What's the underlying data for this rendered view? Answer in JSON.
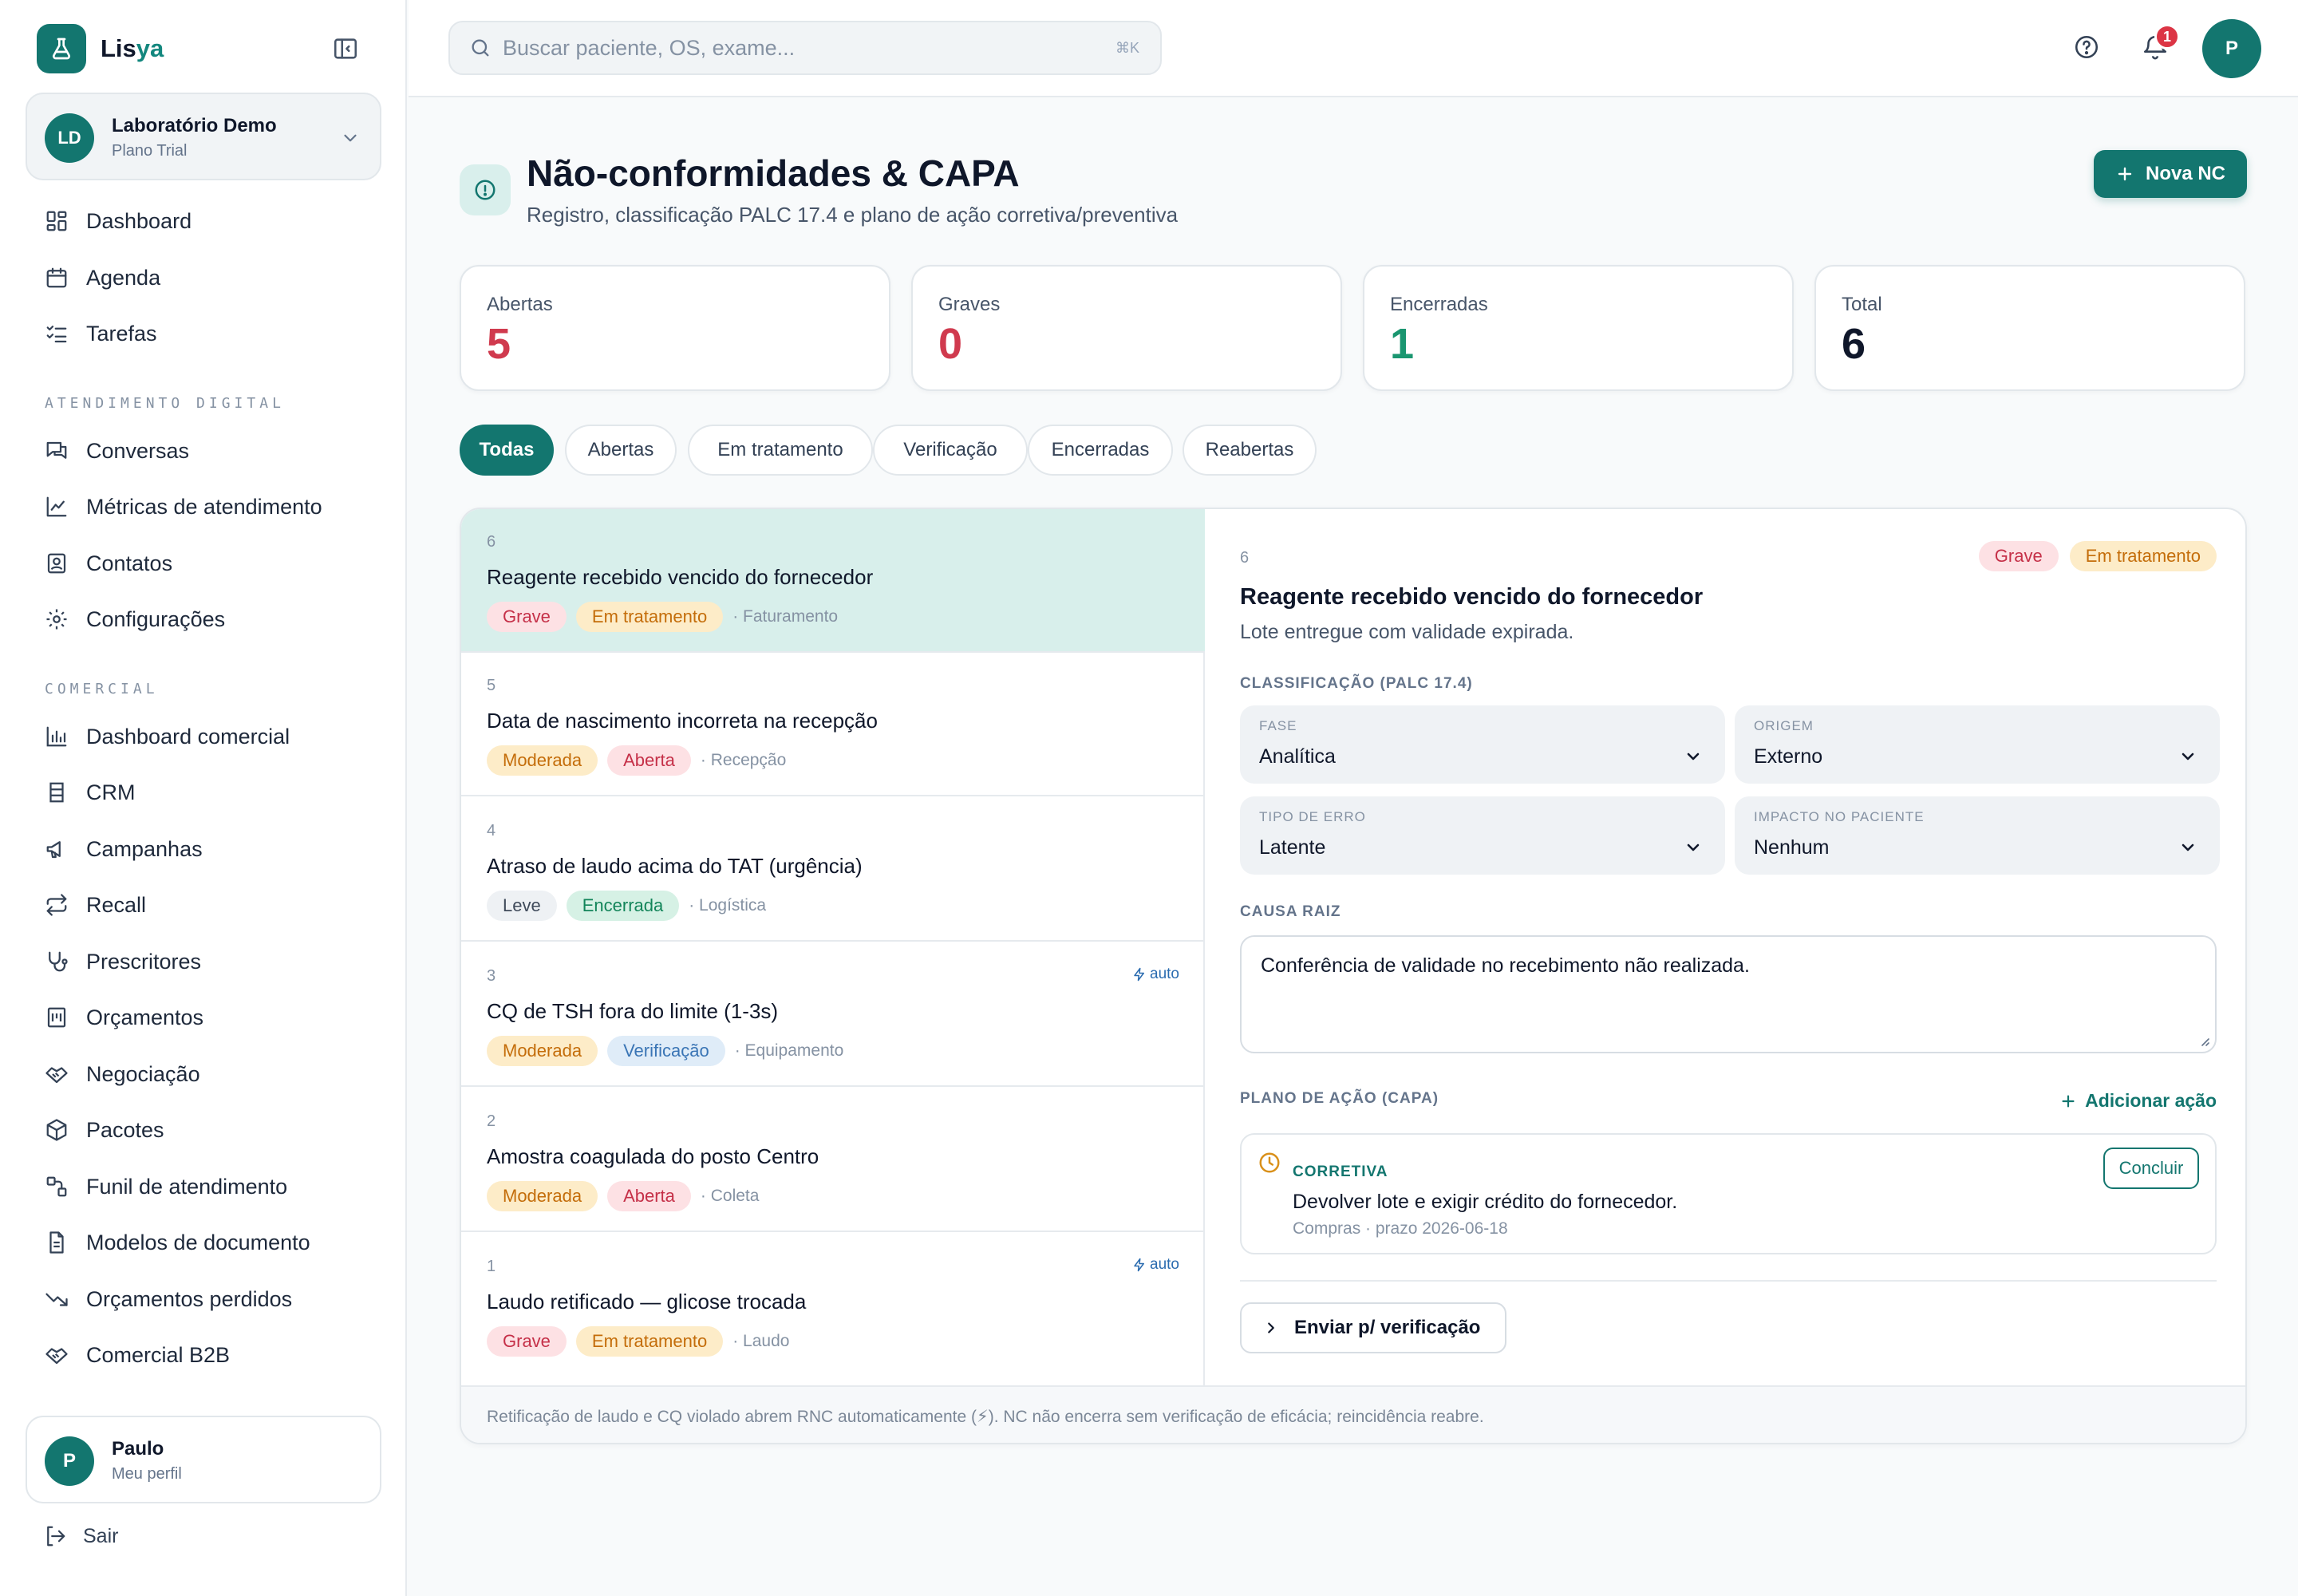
{
  "brand": {
    "name_prefix": "Lis",
    "name_suffix": "ya"
  },
  "org": {
    "initials": "LD",
    "name": "Laboratório Demo",
    "plan": "Plano Trial"
  },
  "nav": {
    "main": [
      {
        "label": "Dashboard",
        "icon": "dashboard-icon"
      },
      {
        "label": "Agenda",
        "icon": "calendar-icon"
      },
      {
        "label": "Tarefas",
        "icon": "tasks-icon"
      }
    ],
    "section_atendimento": "ATENDIMENTO DIGITAL",
    "atendimento": [
      {
        "label": "Conversas",
        "icon": "chat-icon"
      },
      {
        "label": "Métricas de atendimento",
        "icon": "line-chart-icon"
      },
      {
        "label": "Contatos",
        "icon": "contacts-icon"
      },
      {
        "label": "Configurações",
        "icon": "gear-icon"
      }
    ],
    "section_comercial": "COMERCIAL",
    "comercial": [
      {
        "label": "Dashboard comercial",
        "icon": "bar-chart-icon"
      },
      {
        "label": "CRM",
        "icon": "crm-icon"
      },
      {
        "label": "Campanhas",
        "icon": "megaphone-icon"
      },
      {
        "label": "Recall",
        "icon": "repeat-icon"
      },
      {
        "label": "Prescritores",
        "icon": "stethoscope-icon"
      },
      {
        "label": "Orçamentos",
        "icon": "receipt-icon"
      },
      {
        "label": "Negociação",
        "icon": "handshake-icon"
      },
      {
        "label": "Pacotes",
        "icon": "package-icon"
      },
      {
        "label": "Funil de atendimento",
        "icon": "funnel-icon"
      },
      {
        "label": "Modelos de documento",
        "icon": "document-icon"
      },
      {
        "label": "Orçamentos perdidos",
        "icon": "trend-down-icon"
      },
      {
        "label": "Comercial B2B",
        "icon": "handshake-icon"
      }
    ]
  },
  "user": {
    "initial": "P",
    "name": "Paulo",
    "sub": "Meu perfil"
  },
  "logout_label": "Sair",
  "topbar": {
    "search_placeholder": "Buscar paciente, OS, exame...",
    "shortcut": "⌘K",
    "notifications": "1",
    "avatar": "P"
  },
  "header": {
    "title": "Não-conformidades & CAPA",
    "subtitle": "Registro, classificação PALC 17.4 e plano de ação corretiva/preventiva",
    "new_button": "Nova NC"
  },
  "stats": [
    {
      "label": "Abertas",
      "value": "5",
      "color": "#d03a4e"
    },
    {
      "label": "Graves",
      "value": "0",
      "color": "#d03a4e"
    },
    {
      "label": "Encerradas",
      "value": "1",
      "color": "#1a9670"
    },
    {
      "label": "Total",
      "value": "6",
      "color": "#0f172a"
    }
  ],
  "filters": [
    "Todas",
    "Abertas",
    "Em tratamento",
    "Verificação",
    "Encerradas",
    "Reabertas"
  ],
  "list": [
    {
      "num": "6",
      "title": "Reagente recebido vencido do fornecedor",
      "severity": "Grave",
      "sev_class": "grave",
      "status": "Em tratamento",
      "status_class": "tratamento",
      "area": "· Faturamento",
      "auto": ""
    },
    {
      "num": "5",
      "title": "Data de nascimento incorreta na recepção",
      "severity": "Moderada",
      "sev_class": "moderada",
      "status": "Aberta",
      "status_class": "aberta",
      "area": "· Recepção",
      "auto": ""
    },
    {
      "num": "4",
      "title": "Atraso de laudo acima do TAT (urgência)",
      "severity": "Leve",
      "sev_class": "leve",
      "status": "Encerrada",
      "status_class": "encerrada",
      "area": "· Logística",
      "auto": ""
    },
    {
      "num": "3",
      "title": "CQ de TSH fora do limite (1-3s)",
      "severity": "Moderada",
      "sev_class": "moderada",
      "status": "Verificação",
      "status_class": "verificacao",
      "area": "· Equipamento",
      "auto": "auto"
    },
    {
      "num": "2",
      "title": "Amostra coagulada do posto Centro",
      "severity": "Moderada",
      "sev_class": "moderada",
      "status": "Aberta",
      "status_class": "aberta",
      "area": "· Coleta",
      "auto": ""
    },
    {
      "num": "1",
      "title": "Laudo retificado — glicose trocada",
      "severity": "Grave",
      "sev_class": "grave",
      "status": "Em tratamento",
      "status_class": "tratamento",
      "area": "· Laudo",
      "auto": "auto"
    }
  ],
  "detail": {
    "num": "6",
    "severity": "Grave",
    "status": "Em tratamento",
    "title": "Reagente recebido vencido do fornecedor",
    "description": "Lote entregue com validade expirada.",
    "classification_label": "CLASSIFICAÇÃO (PALC 17.4)",
    "fields": [
      {
        "label": "FASE",
        "value": "Analítica"
      },
      {
        "label": "ORIGEM",
        "value": "Externo"
      },
      {
        "label": "TIPO DE ERRO",
        "value": "Latente"
      },
      {
        "label": "IMPACTO NO PACIENTE",
        "value": "Nenhum"
      }
    ],
    "root_cause_label": "CAUSA RAIZ",
    "root_cause": "Conferência de validade no recebimento não realizada.",
    "plan_label": "PLANO DE AÇÃO (CAPA)",
    "add_action": "Adicionar ação",
    "action": {
      "type": "CORRETIVA",
      "text": "Devolver lote e exigir crédito do fornecedor.",
      "meta": "Compras · prazo 2026-06-18",
      "button": "Concluir"
    },
    "send_button": "Enviar p/ verificação"
  },
  "footer_note": "Retificação de laudo e CQ violado abrem RNC automaticamente (⚡). NC não encerra sem verificação de eficácia; reincidência reabre.",
  "colors": {
    "primary": "#13766f",
    "danger": "#d03a4e",
    "success": "#1a9670"
  }
}
